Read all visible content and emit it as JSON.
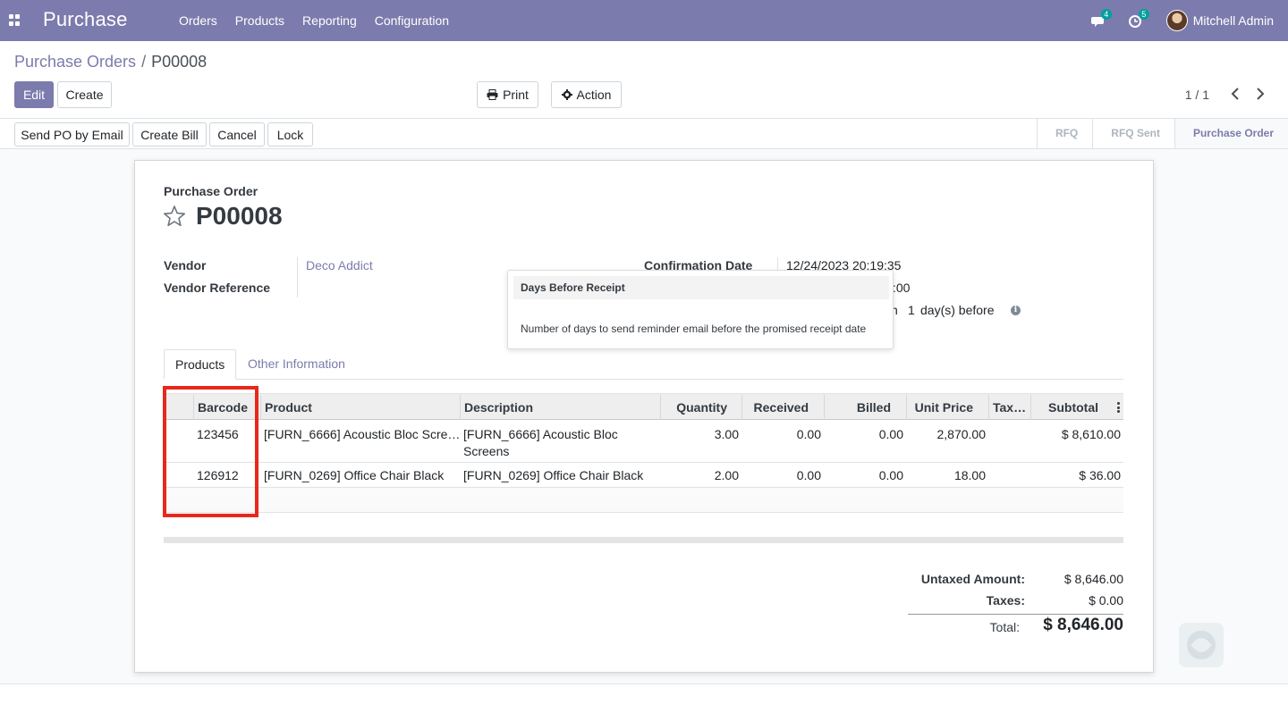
{
  "navbar": {
    "app_name": "Purchase",
    "menu": [
      "Orders",
      "Products",
      "Reporting",
      "Configuration"
    ],
    "messages_count": "4",
    "activities_count": "5",
    "user_name": "Mitchell Admin"
  },
  "breadcrumb": {
    "parent": "Purchase Orders",
    "separator": "/",
    "current": "P00008"
  },
  "buttons": {
    "edit": "Edit",
    "create": "Create",
    "print": "Print",
    "action": "Action"
  },
  "pager": {
    "text": "1 / 1"
  },
  "statusbar": {
    "buttons": [
      "Send PO by Email",
      "Create Bill",
      "Cancel",
      "Lock"
    ],
    "stages": [
      "RFQ",
      "RFQ Sent",
      "Purchase Order"
    ],
    "active_stage": "Purchase Order"
  },
  "form": {
    "heading_label": "Purchase Order",
    "name": "P00008",
    "vendor_label": "Vendor",
    "vendor_value": "Deco Addict",
    "vendor_ref_label": "Vendor Reference",
    "confirmation_label": "Confirmation Date",
    "confirmation_value": "12/24/2023 20:19:35",
    "partial_time": ":00",
    "reminder_partial": "n",
    "reminder_days": "1",
    "reminder_suffix": "day(s) before"
  },
  "tooltip": {
    "title": "Days Before Receipt",
    "body": "Number of days to send reminder email before the promised receipt date"
  },
  "tabs": [
    "Products",
    "Other Information"
  ],
  "table": {
    "headers": [
      "Barcode",
      "Product",
      "Description",
      "Quantity",
      "Received",
      "Billed",
      "Unit Price",
      "Tax…",
      "Subtotal"
    ],
    "rows": [
      {
        "barcode": "123456",
        "product": "[FURN_6666] Acoustic Bloc Scre…",
        "description_line1": "[FURN_6666] Acoustic Bloc",
        "description_line2": "Screens",
        "quantity": "3.00",
        "received": "0.00",
        "billed": "0.00",
        "unit_price": "2,870.00",
        "taxes": "",
        "subtotal": "$ 8,610.00"
      },
      {
        "barcode": "126912",
        "product": "[FURN_0269] Office Chair Black",
        "description_line1": "[FURN_0269] Office Chair Black",
        "description_line2": "",
        "quantity": "2.00",
        "received": "0.00",
        "billed": "0.00",
        "unit_price": "18.00",
        "taxes": "",
        "subtotal": "$ 36.00"
      }
    ]
  },
  "totals": {
    "untaxed_label": "Untaxed Amount:",
    "untaxed_value": "$ 8,646.00",
    "taxes_label": "Taxes:",
    "taxes_value": "$ 0.00",
    "total_label": "Total:",
    "total_value": "$ 8,646.00"
  },
  "colors": {
    "brand": "#7c7bad",
    "highlight": "#e8281c",
    "badge": "#00a09d"
  },
  "icons": [
    "apps-icon",
    "chat-icon",
    "clock-icon",
    "print-icon",
    "gear-icon",
    "chevron-left-icon",
    "chevron-right-icon",
    "star-icon",
    "info-icon",
    "kebab-icon"
  ]
}
